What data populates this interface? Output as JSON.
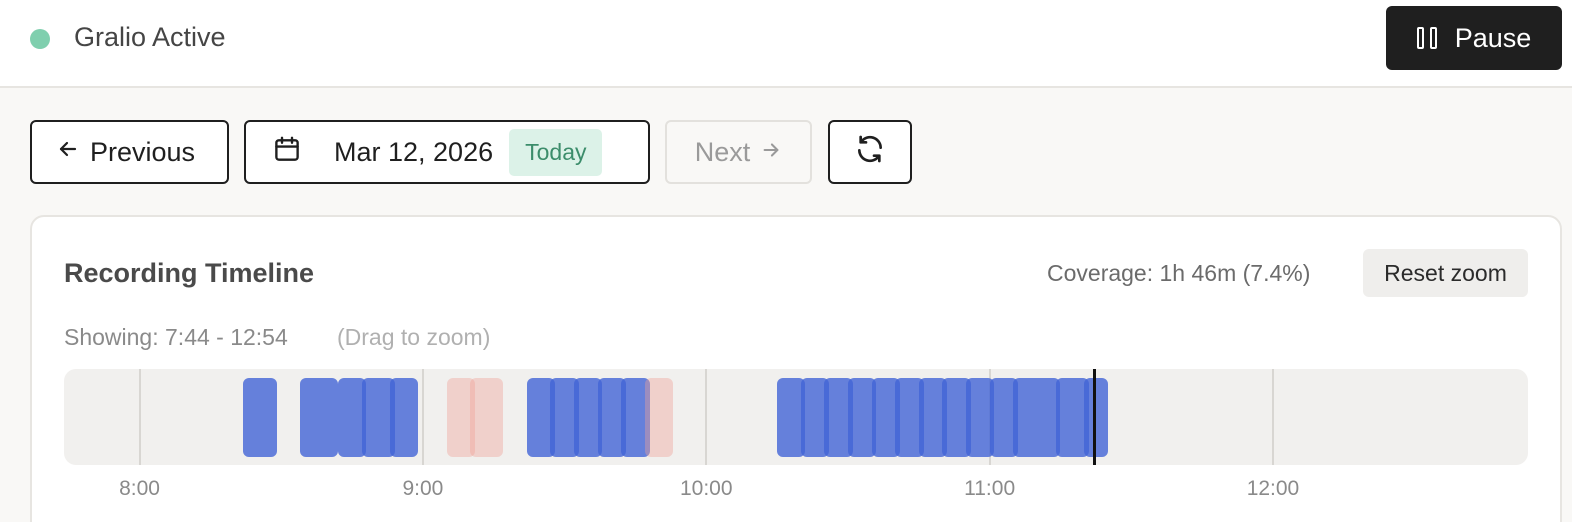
{
  "header": {
    "status_label": "Gralio Active",
    "status_color": "#7fcfae",
    "pause_label": "Pause",
    "pause_icon": "pause-icon"
  },
  "nav": {
    "previous_label": "Previous",
    "previous_icon": "arrow-left-icon",
    "date_icon": "calendar-icon",
    "date_label": "Mar 12, 2026",
    "today_badge": "Today",
    "next_label": "Next",
    "next_icon": "arrow-right-icon",
    "refresh_icon": "refresh-icon"
  },
  "timeline": {
    "title": "Recording Timeline",
    "coverage": "Coverage: 1h 46m (7.4%)",
    "reset_label": "Reset zoom",
    "showing": "Showing: 7:44 - 12:54",
    "hint": "(Drag to zoom)",
    "range_start": "7:44",
    "range_end": "12:54",
    "now_time": "11:22",
    "colors": {
      "recorded": "#4264d6",
      "gap": "#f0a096"
    },
    "ticks": [
      "8:00",
      "9:00",
      "10:00",
      "11:00",
      "12:00"
    ],
    "segments": [
      {
        "start": "8:22",
        "end": "8:29",
        "kind": "recorded"
      },
      {
        "start": "8:34",
        "end": "8:42",
        "kind": "recorded"
      },
      {
        "start": "8:42",
        "end": "8:48",
        "kind": "recorded"
      },
      {
        "start": "8:47",
        "end": "8:54",
        "kind": "recorded"
      },
      {
        "start": "8:53",
        "end": "8:59",
        "kind": "recorded"
      },
      {
        "start": "9:05",
        "end": "9:11",
        "kind": "gap"
      },
      {
        "start": "9:10",
        "end": "9:17",
        "kind": "gap"
      },
      {
        "start": "9:22",
        "end": "9:28",
        "kind": "recorded"
      },
      {
        "start": "9:27",
        "end": "9:33",
        "kind": "recorded"
      },
      {
        "start": "9:32",
        "end": "9:38",
        "kind": "recorded"
      },
      {
        "start": "9:37",
        "end": "9:43",
        "kind": "recorded"
      },
      {
        "start": "9:42",
        "end": "9:48",
        "kind": "recorded"
      },
      {
        "start": "9:47",
        "end": "9:53",
        "kind": "gap"
      },
      {
        "start": "10:15",
        "end": "10:21",
        "kind": "recorded"
      },
      {
        "start": "10:20",
        "end": "10:26",
        "kind": "recorded"
      },
      {
        "start": "10:25",
        "end": "10:31",
        "kind": "recorded"
      },
      {
        "start": "10:30",
        "end": "10:36",
        "kind": "recorded"
      },
      {
        "start": "10:35",
        "end": "10:41",
        "kind": "recorded"
      },
      {
        "start": "10:40",
        "end": "10:46",
        "kind": "recorded"
      },
      {
        "start": "10:45",
        "end": "10:51",
        "kind": "recorded"
      },
      {
        "start": "10:50",
        "end": "10:56",
        "kind": "recorded"
      },
      {
        "start": "10:55",
        "end": "11:01",
        "kind": "recorded"
      },
      {
        "start": "11:00",
        "end": "11:06",
        "kind": "recorded"
      },
      {
        "start": "11:05",
        "end": "11:15",
        "kind": "recorded"
      },
      {
        "start": "11:14",
        "end": "11:21",
        "kind": "recorded"
      },
      {
        "start": "11:20",
        "end": "11:25",
        "kind": "recorded"
      }
    ]
  }
}
